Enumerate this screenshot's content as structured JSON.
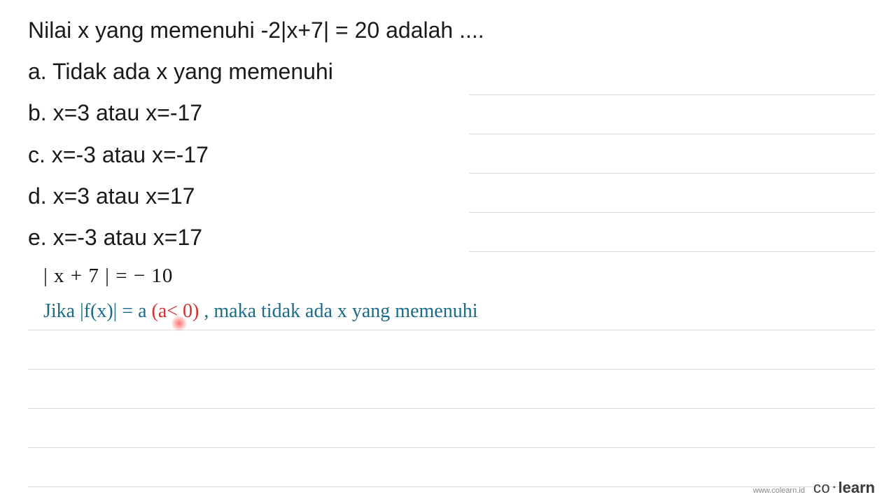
{
  "question": "Nilai x yang memenuhi -2|x+7| = 20 adalah ....",
  "options": {
    "a": "a. Tidak ada x yang memenuhi",
    "b": "b. x=3 atau x=-17",
    "c": "c. x=-3 atau x=-17",
    "d": "d. x=3 atau x=17",
    "e": "e. x=-3 atau x=17"
  },
  "work": {
    "line1": "| x + 7 |  =  − 10",
    "line2_pre": "Jika  |f(x)|  =  a ",
    "line2_red": "(a< 0)",
    "line2_post": " , maka  tidak  ada  x  yang  memenuhi"
  },
  "footer": {
    "url": "www.colearn.id",
    "logo_co": "co",
    "logo_dot": "·",
    "logo_learn": "learn"
  }
}
